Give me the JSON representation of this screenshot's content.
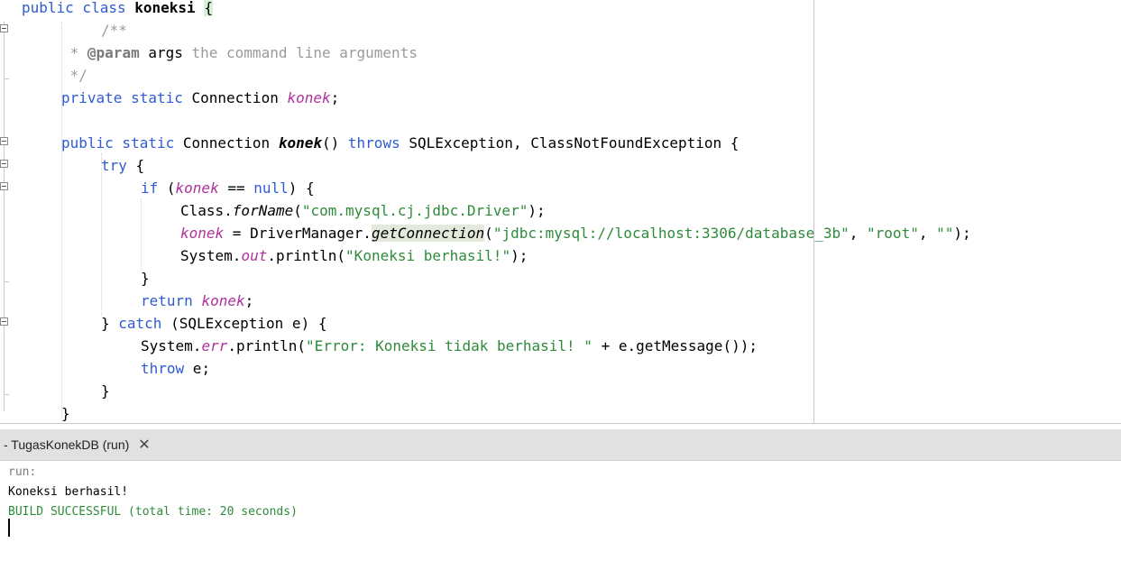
{
  "editor": {
    "lines": {
      "l1": {
        "kw": "public class ",
        "name": "koneksi",
        "sp": " ",
        "brace": "{"
      },
      "l2": {
        "text": "/**"
      },
      "l3": {
        "star": " * ",
        "tag": "@param",
        "rest": " args ",
        "desc": "the command line arguments"
      },
      "l4": {
        "text": " */"
      },
      "l5": {
        "kw": "private static ",
        "type": "Connection ",
        "field": "konek",
        "end": ";"
      },
      "l6": {
        "kw": "public static ",
        "type": "Connection ",
        "name": "konek",
        "parens": "() ",
        "kw2": "throws ",
        "rest": "SQLException, ClassNotFoundException {"
      },
      "l7": {
        "kw": "try",
        "rest": " {"
      },
      "l8": {
        "kw": "if",
        "open": " (",
        "field": "konek",
        "op": " == ",
        "kw2": "null",
        "rest": ") {"
      },
      "l9": {
        "pre": "Class.",
        "method": "forName",
        "open": "(",
        "str": "\"com.mysql.cj.jdbc.Driver\"",
        "end": ");"
      },
      "l10": {
        "field": "konek",
        "pre": " = DriverManager.",
        "method": "getConnection",
        "open": "(",
        "s1": "\"jdbc:mysql://localhost:3306/database_3b\"",
        "c1": ", ",
        "s2": "\"root\"",
        "c2": ", ",
        "s3": "\"\"",
        "end": ");"
      },
      "l11": {
        "pre": "System.",
        "field": "out",
        "mid": ".println(",
        "str": "\"Koneksi berhasil!\"",
        "end": ");"
      },
      "l12": {
        "text": "}"
      },
      "l13": {
        "kw": "return ",
        "field": "konek",
        "end": ";"
      },
      "l14": {
        "pre": "} ",
        "kw": "catch",
        "rest": " (SQLException e) {"
      },
      "l15": {
        "pre": "System.",
        "field": "err",
        "mid": ".println(",
        "str": "\"Error: Koneksi tidak berhasil! \"",
        "rest": " + e.getMessage",
        "paren": "()",
        "end": ");"
      },
      "l16": {
        "kw": "throw",
        "rest": " e;"
      },
      "l17": {
        "text": "}"
      },
      "l18": {
        "text": "}"
      }
    }
  },
  "output": {
    "tab_label": "- TugasKonekDB (run)",
    "close_glyph": "✕",
    "lines": [
      "run:",
      "Koneksi berhasil!",
      "BUILD SUCCESSFUL (total time: 20 seconds)"
    ]
  },
  "colors": {
    "keyword": "#2f5bd3",
    "field": "#b0329c",
    "string": "#2e8b3a",
    "comment": "#9a9a9a",
    "build_success": "#2e8b3a"
  }
}
